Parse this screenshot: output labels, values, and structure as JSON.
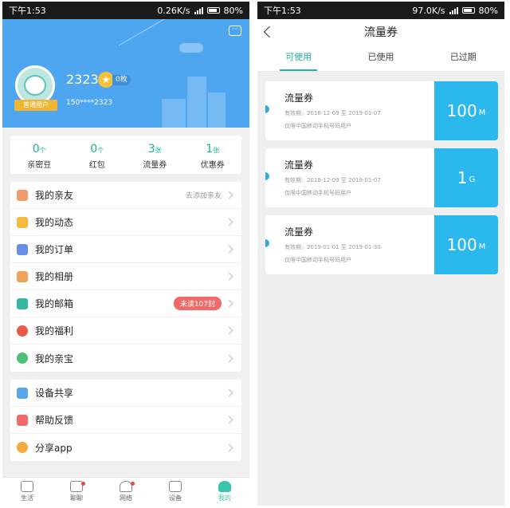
{
  "status_left": {
    "time": "下午1:53",
    "speed": "0.26K/s",
    "battery": "80%"
  },
  "status_right": {
    "time": "下午1:53",
    "speed": "97.0K/s",
    "battery": "80%"
  },
  "profile": {
    "username": "2323",
    "medal_count": "0枚",
    "phone": "150****2323",
    "level": "普通用户"
  },
  "stats": [
    {
      "value": "0",
      "unit": "个",
      "label": "亲密豆"
    },
    {
      "value": "0",
      "unit": "个",
      "label": "红包"
    },
    {
      "value": "3",
      "unit": "张",
      "label": "流量券"
    },
    {
      "value": "1",
      "unit": "张",
      "label": "优惠券"
    }
  ],
  "menu1": [
    {
      "label": "我的亲友",
      "hint": "去添加亲友",
      "color": "#f39a6a"
    },
    {
      "label": "我的动态",
      "color": "#f5b93c"
    },
    {
      "label": "我的订单",
      "color": "#6a8ee8"
    },
    {
      "label": "我的相册",
      "color": "#f2a35a"
    },
    {
      "label": "我的邮箱",
      "badge": "未读107封",
      "color": "#36b8a0"
    },
    {
      "label": "我的福利",
      "color": "#e85a4a"
    },
    {
      "label": "我的亲宝",
      "color": "#4cc077"
    }
  ],
  "menu2": [
    {
      "label": "设备共享",
      "color": "#5aa6e8"
    },
    {
      "label": "帮助反馈",
      "color": "#ef6b6b"
    },
    {
      "label": "分享app",
      "color": "#f5a93c"
    }
  ],
  "tabbar": [
    {
      "label": "生活"
    },
    {
      "label": "聊聊"
    },
    {
      "label": "网络"
    },
    {
      "label": "设备"
    },
    {
      "label": "我的"
    }
  ],
  "coupons_page": {
    "title": "流量券",
    "tabs": [
      "可使用",
      "已使用",
      "已过期"
    ],
    "coupons": [
      {
        "title": "流量券",
        "validity": "有效期：2018-12-09 至 2019-01-07",
        "scope": "仅限中国移动手机号码用户",
        "value": "100",
        "unit": "M"
      },
      {
        "title": "流量券",
        "validity": "有效期：2018-12-09 至 2019-01-07",
        "scope": "仅限中国移动手机号码用户",
        "value": "1",
        "unit": "G"
      },
      {
        "title": "流量券",
        "validity": "有效期：2019-01-01 至 2019-01-30",
        "scope": "仅限中国移动手机号码用户",
        "value": "100",
        "unit": "M"
      }
    ]
  },
  "colors": {
    "accent": "#1fb29e",
    "header_blue": "#4fa6f0",
    "coupon_blue": "#2bb8ec"
  }
}
